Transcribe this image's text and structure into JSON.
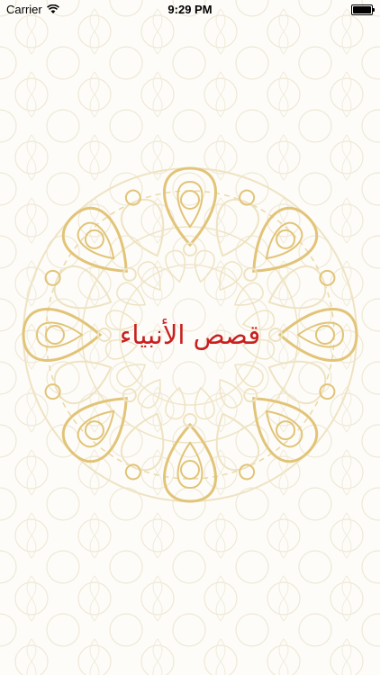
{
  "status_bar": {
    "carrier": "Carrier",
    "time": "9:29 PM",
    "wifi_icon": "wifi-icon",
    "battery_icon": "battery-icon"
  },
  "main": {
    "title": "قصص الأنبياء"
  },
  "colors": {
    "background": "#fdfcf8",
    "ornament_gold": "#e2c478",
    "ornament_light": "#eee3c2",
    "title_red": "#c9201f"
  }
}
